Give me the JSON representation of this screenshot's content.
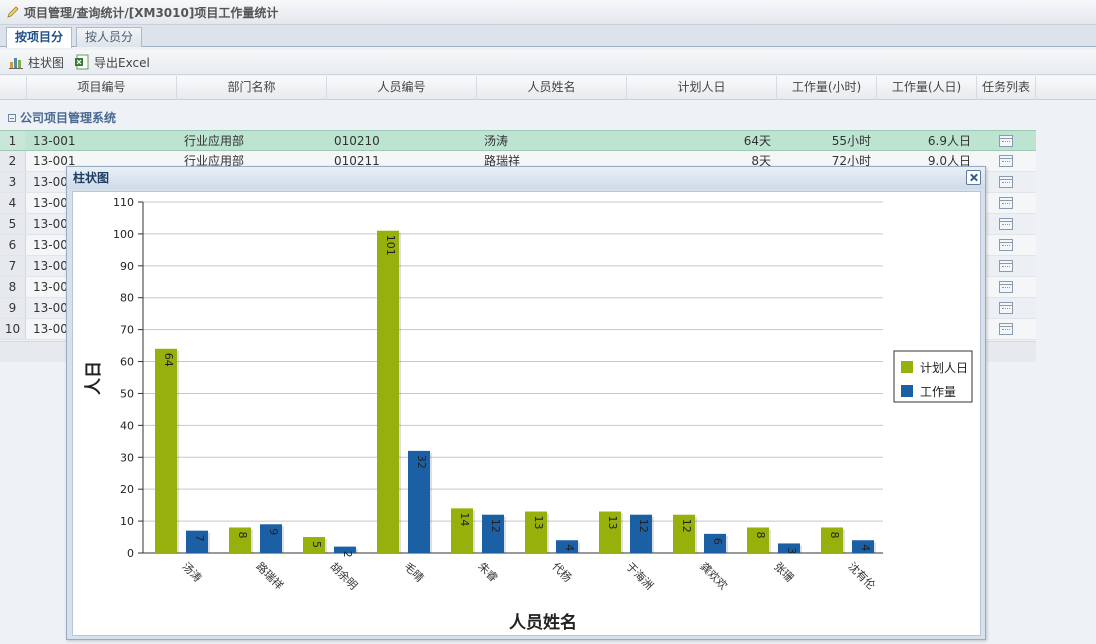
{
  "breadcrumb": "项目管理/查询统计/[XM3010]项目工作量统计",
  "tabs": [
    {
      "label": "按项目分",
      "active": true
    },
    {
      "label": "按人员分",
      "active": false
    }
  ],
  "toolbar": {
    "chart_label": "柱状图",
    "export_label": "导出Excel"
  },
  "columns": [
    "项目编号",
    "部门名称",
    "人员编号",
    "人员姓名",
    "计划人日",
    "工作量(小时)",
    "工作量(人日)",
    "任务列表"
  ],
  "group_label": "公司项目管理系统",
  "rows": [
    {
      "n": "1",
      "project": "13-001",
      "dept": "行业应用部",
      "emp_no": "010210",
      "name": "汤涛",
      "plan": "64天",
      "hours": "55小时",
      "days": "6.9人日"
    },
    {
      "n": "2",
      "project": "13-001",
      "dept": "行业应用部",
      "emp_no": "010211",
      "name": "路瑞祥",
      "plan": "8天",
      "hours": "72小时",
      "days": "9.0人日"
    },
    {
      "n": "3",
      "project": "13-00"
    },
    {
      "n": "4",
      "project": "13-00"
    },
    {
      "n": "5",
      "project": "13-00"
    },
    {
      "n": "6",
      "project": "13-00"
    },
    {
      "n": "7",
      "project": "13-00"
    },
    {
      "n": "8",
      "project": "13-00"
    },
    {
      "n": "9",
      "project": "13-00"
    },
    {
      "n": "10",
      "project": "13-00"
    }
  ],
  "dialog": {
    "title": "柱状图"
  },
  "colors": {
    "plan": "#98b00c",
    "work": "#1b60a5"
  },
  "chart_data": {
    "type": "bar",
    "categories": [
      "汤涛",
      "路瑞祥",
      "胡余明",
      "毛晴",
      "朱睿",
      "代杨",
      "于海洲",
      "龚欢欢",
      "张珊",
      "沈有伦"
    ],
    "series": [
      {
        "name": "计划人日",
        "values": [
          64,
          8,
          5,
          101,
          14,
          13,
          13,
          12,
          8,
          8
        ]
      },
      {
        "name": "工作量",
        "values": [
          7,
          9,
          2,
          32,
          12,
          4,
          12,
          6,
          3,
          4
        ]
      }
    ],
    "xlabel": "人员姓名",
    "ylabel": "人日",
    "ylim": [
      0,
      110
    ],
    "yticks": [
      0,
      10,
      20,
      30,
      40,
      50,
      60,
      70,
      80,
      90,
      100,
      110
    ],
    "grid": true,
    "legend": "right"
  }
}
